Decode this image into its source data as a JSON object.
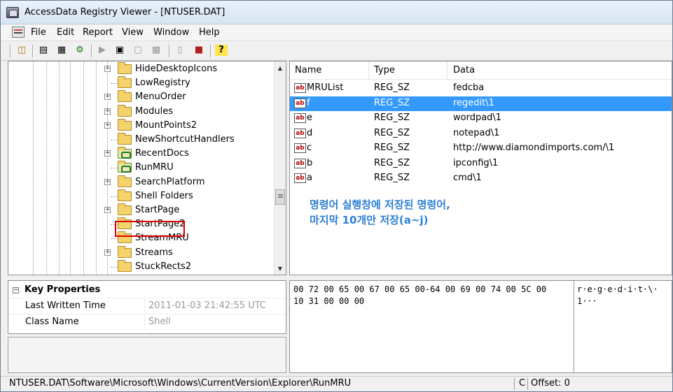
{
  "window": {
    "title": "AccessData Registry Viewer - [NTUSER.DAT]"
  },
  "menu": [
    "File",
    "Edit",
    "Report",
    "View",
    "Window",
    "Help"
  ],
  "tree": {
    "items": [
      {
        "label": "HideDesktopIcons",
        "expandable": true,
        "icon": "folder-icon"
      },
      {
        "label": "LowRegistry",
        "expandable": false,
        "icon": "folder-icon"
      },
      {
        "label": "MenuOrder",
        "expandable": true,
        "icon": "folder-icon"
      },
      {
        "label": "Modules",
        "expandable": true,
        "icon": "folder-icon"
      },
      {
        "label": "MountPoints2",
        "expandable": true,
        "icon": "folder-icon"
      },
      {
        "label": "NewShortcutHandlers",
        "expandable": false,
        "icon": "folder-icon"
      },
      {
        "label": "RecentDocs",
        "expandable": true,
        "icon": "key-folder-icon"
      },
      {
        "label": "RunMRU",
        "expandable": false,
        "icon": "key-folder-icon",
        "highlighted": true
      },
      {
        "label": "SearchPlatform",
        "expandable": true,
        "icon": "folder-icon"
      },
      {
        "label": "Shell Folders",
        "expandable": false,
        "icon": "folder-icon"
      },
      {
        "label": "StartPage",
        "expandable": true,
        "icon": "folder-icon"
      },
      {
        "label": "StartPage2",
        "expandable": false,
        "icon": "folder-icon"
      },
      {
        "label": "StreamMRU",
        "expandable": false,
        "icon": "folder-icon"
      },
      {
        "label": "Streams",
        "expandable": true,
        "icon": "folder-icon"
      },
      {
        "label": "StuckRects2",
        "expandable": false,
        "icon": "folder-icon"
      }
    ]
  },
  "list": {
    "columns": [
      "Name",
      "Type",
      "Data"
    ],
    "rows": [
      {
        "name": "MRUList",
        "type": "REG_SZ",
        "data": "fedcba",
        "selected": false
      },
      {
        "name": "f",
        "type": "REG_SZ",
        "data": "regedit\\1",
        "selected": true
      },
      {
        "name": "e",
        "type": "REG_SZ",
        "data": "wordpad\\1",
        "selected": false
      },
      {
        "name": "d",
        "type": "REG_SZ",
        "data": "notepad\\1",
        "selected": false
      },
      {
        "name": "c",
        "type": "REG_SZ",
        "data": "http://www.diamondimports.com/\\1",
        "selected": false
      },
      {
        "name": "b",
        "type": "REG_SZ",
        "data": "ipconfig\\1",
        "selected": false
      },
      {
        "name": "a",
        "type": "REG_SZ",
        "data": "cmd\\1",
        "selected": false
      }
    ],
    "value_icon_text": "ab",
    "annotation": [
      "명령어 실행창에 저장된 명령어,",
      "마지막 10개만 저장(a~j)"
    ]
  },
  "properties": {
    "header": "Key Properties",
    "rows": [
      {
        "name": "Last Written Time",
        "value": "2011-01-03 21:42:55 UTC"
      },
      {
        "name": "Class Name",
        "value": "Shell"
      }
    ]
  },
  "hex": {
    "lines": [
      {
        "hex": "00 72 00 65 00 67 00 65 00-64 00 69 00 74 00 5C 00",
        "ascii": "r·e·g·e·d·i·t·\\·"
      },
      {
        "hex": "10 31 00 00 00",
        "ascii": "1···"
      }
    ]
  },
  "status": {
    "path": "NTUSER.DAT\\Software\\Microsoft\\Windows\\CurrentVersion\\Explorer\\RunMRU",
    "caps": "C",
    "offset": "Offset: 0"
  },
  "colors": {
    "selection": "#3399ff",
    "annotation": "#2d7fd2",
    "highlight_box": "#e00000"
  }
}
